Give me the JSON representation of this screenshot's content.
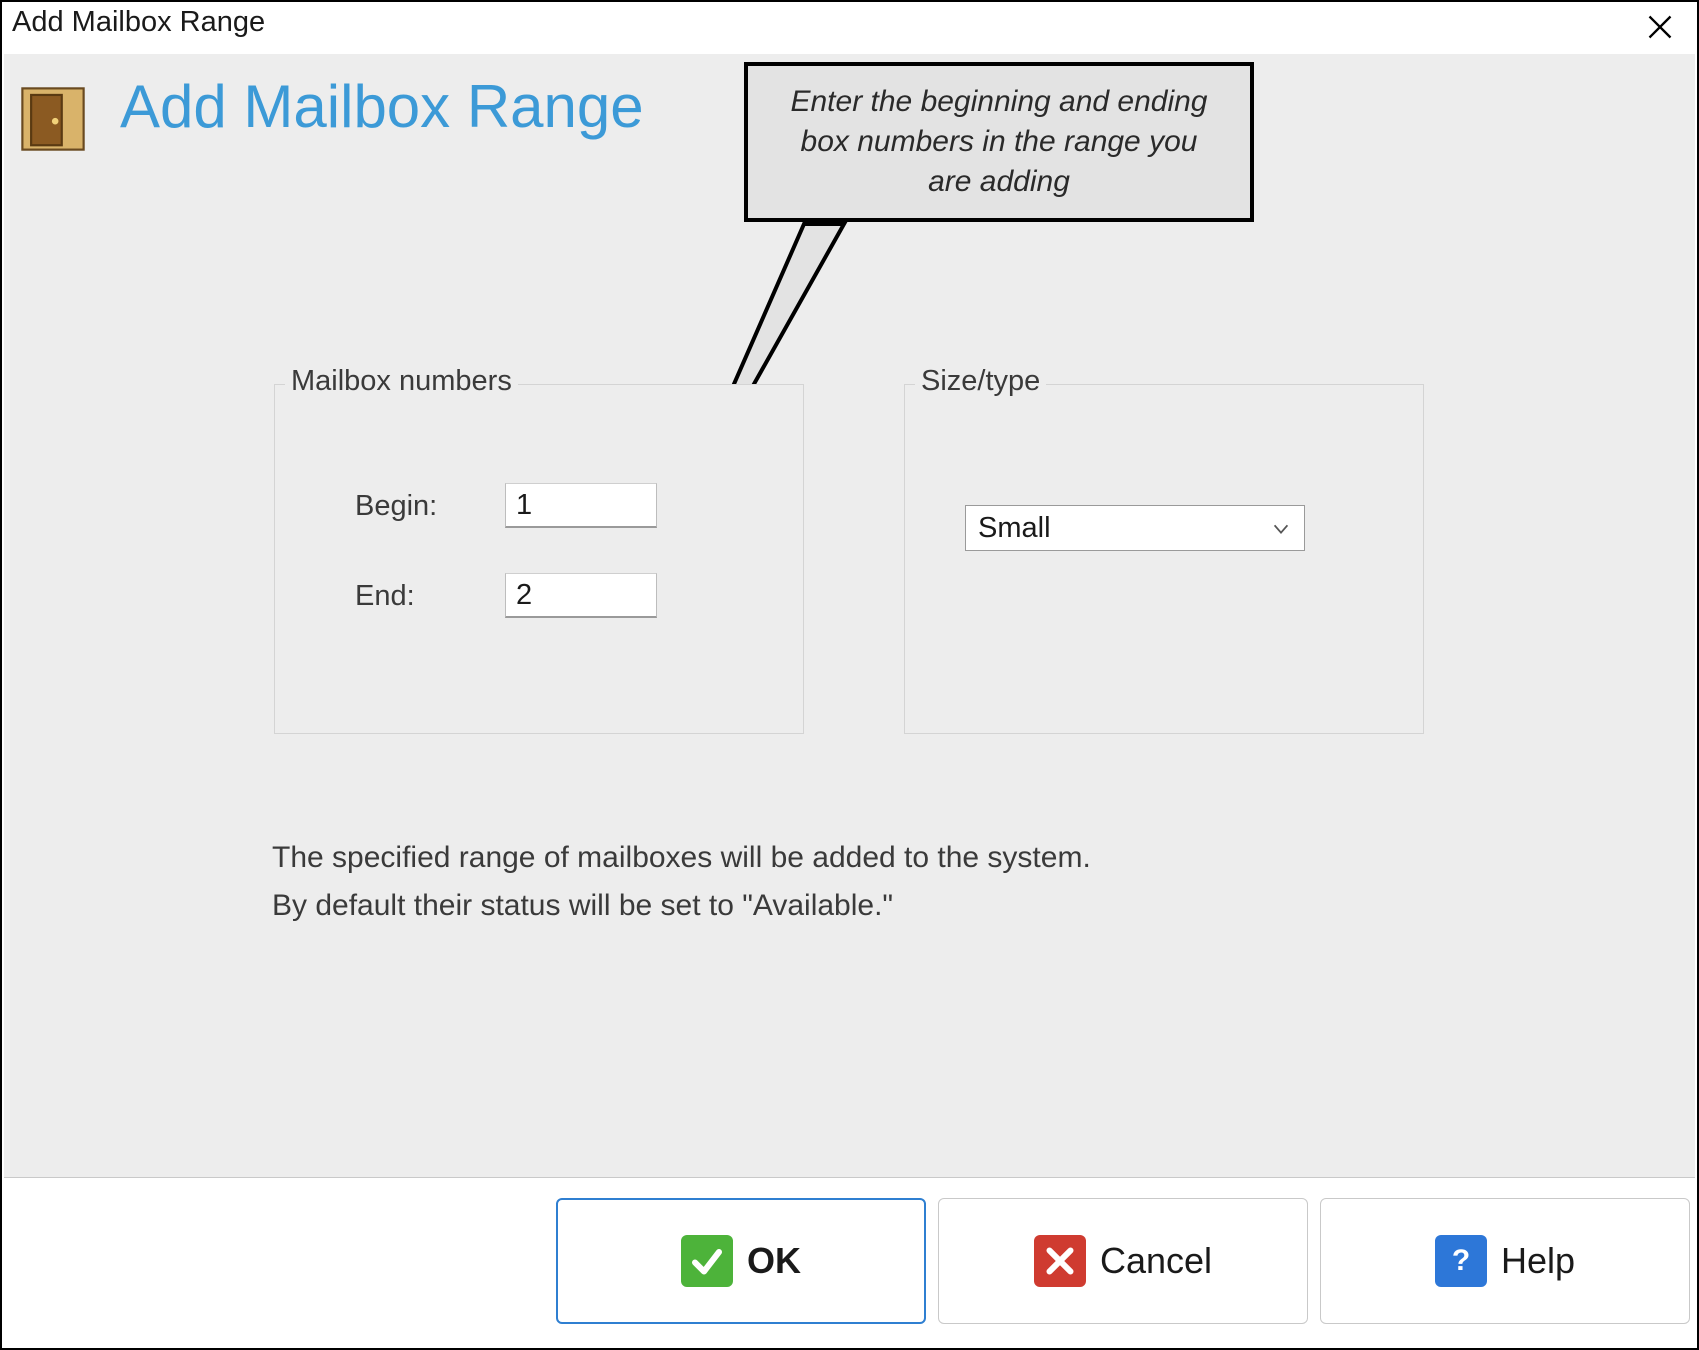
{
  "window": {
    "title": "Add Mailbox Range"
  },
  "header": {
    "title": "Add Mailbox Range"
  },
  "callout": {
    "text": "Enter the beginning and ending box numbers in the range you are adding"
  },
  "groups": {
    "numbers": {
      "legend": "Mailbox numbers",
      "begin_label": "Begin:",
      "end_label": "End:",
      "begin_value": "1",
      "end_value": "2"
    },
    "size": {
      "legend": "Size/type",
      "selected": "Small"
    }
  },
  "description": "The specified range of mailboxes will be added to the system.\nBy default their status will be set to \"Available.\"",
  "buttons": {
    "ok": "OK",
    "cancel": "Cancel",
    "help": "Help"
  }
}
